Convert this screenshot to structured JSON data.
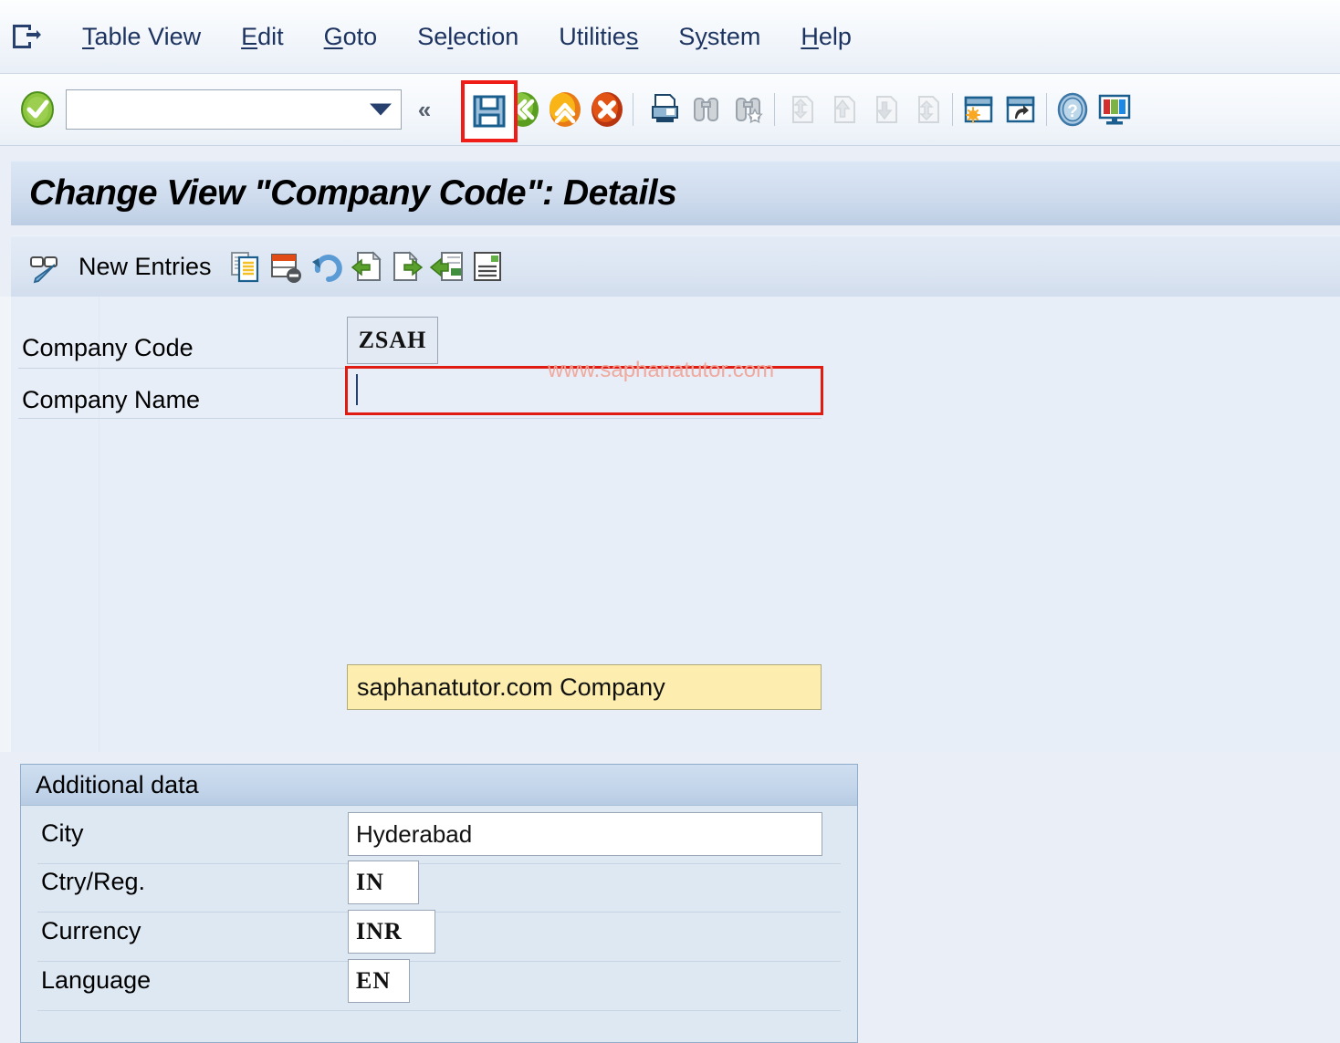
{
  "window": {
    "app_icon": "sap-document-icon"
  },
  "menu": {
    "items": [
      {
        "label": "Table View",
        "accel": "T"
      },
      {
        "label": "Edit",
        "accel": "E"
      },
      {
        "label": "Goto",
        "accel": "G"
      },
      {
        "label": "Selection",
        "accel": "l"
      },
      {
        "label": "Utilities",
        "accel": "s"
      },
      {
        "label": "System",
        "accel": "y"
      },
      {
        "label": "Help",
        "accel": "H"
      }
    ]
  },
  "system_toolbar": {
    "enter_icon": "green-check-icon",
    "command_field": {
      "value": "",
      "placeholder": "",
      "dropdown_icon": "triangle-down-icon"
    },
    "collapse_icon": "double-chevron-left-icon",
    "buttons": [
      {
        "name": "save",
        "icon": "floppy-disk-icon",
        "highlighted": true
      },
      {
        "name": "back",
        "icon": "green-back-arrow-icon"
      },
      {
        "name": "exit",
        "icon": "yellow-exit-up-icon"
      },
      {
        "name": "cancel",
        "icon": "red-cancel-x-icon"
      },
      {
        "name": "print",
        "icon": "printer-icon"
      },
      {
        "name": "find",
        "icon": "binoculars-icon"
      },
      {
        "name": "find-next",
        "icon": "binoculars-plus-icon"
      },
      {
        "name": "first-page",
        "icon": "first-page-icon",
        "disabled": true
      },
      {
        "name": "previous-page",
        "icon": "previous-page-icon",
        "disabled": true
      },
      {
        "name": "next-page",
        "icon": "next-page-icon",
        "disabled": true
      },
      {
        "name": "last-page",
        "icon": "last-page-icon",
        "disabled": true
      },
      {
        "name": "create-session",
        "icon": "new-session-icon"
      },
      {
        "name": "create-shortcut",
        "icon": "shortcut-icon"
      },
      {
        "name": "help",
        "icon": "question-mark-icon"
      },
      {
        "name": "customize-layout",
        "icon": "layout-monitor-icon"
      }
    ]
  },
  "title": {
    "text": "Change View \"Company Code\": Details"
  },
  "app_toolbar": {
    "display_change_icon": "glasses-pencil-icon",
    "new_entries_label": "New Entries",
    "buttons": [
      {
        "name": "copy-as",
        "icon": "copy-document-icon"
      },
      {
        "name": "delete",
        "icon": "delete-row-icon"
      },
      {
        "name": "undo",
        "icon": "undo-arrow-icon"
      },
      {
        "name": "previous-entry",
        "icon": "previous-entry-icon"
      },
      {
        "name": "next-entry",
        "icon": "next-entry-icon"
      },
      {
        "name": "other-entry",
        "icon": "other-entry-icon"
      },
      {
        "name": "details",
        "icon": "details-document-icon"
      }
    ]
  },
  "form": {
    "company_code": {
      "label": "Company Code",
      "value": "ZSAH",
      "readonly": true
    },
    "company_name": {
      "label": "Company Name",
      "value": "saphanatutor.com Company",
      "focused": true
    }
  },
  "additional_data": {
    "group_title": "Additional data",
    "fields": [
      {
        "label": "City",
        "value": "Hyderabad"
      },
      {
        "label": "Ctry/Reg.",
        "value": "IN"
      },
      {
        "label": "Currency",
        "value": "INR"
      },
      {
        "label": "Language",
        "value": "EN"
      }
    ]
  },
  "watermark": {
    "text": "www.saphanatutor.com"
  },
  "colors": {
    "accent_blue": "#27406e",
    "content_bg": "#e8eef7",
    "group_bg": "#dde8f3",
    "focus_field": "#fdeeb0",
    "annotation_red": "#e01b12",
    "watermark_red": "#f0a79c"
  }
}
